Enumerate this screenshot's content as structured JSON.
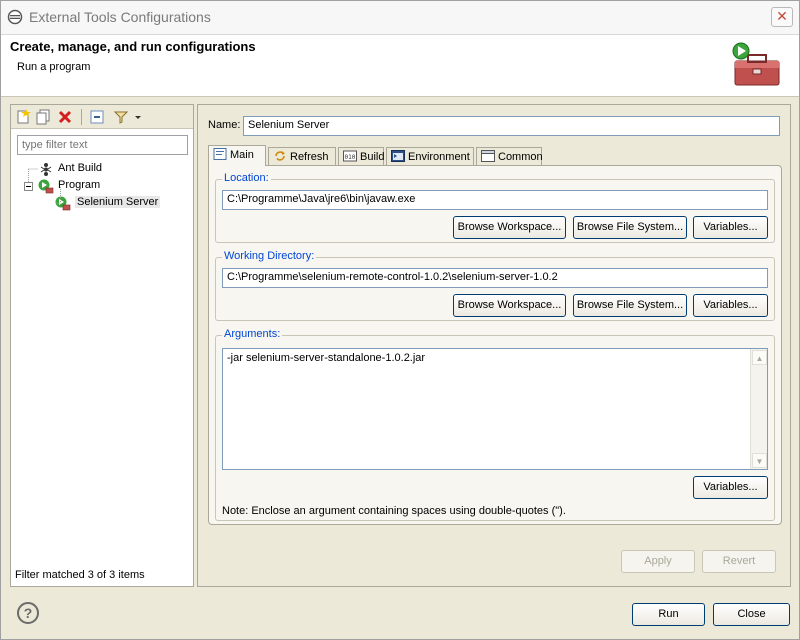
{
  "window": {
    "title": "External Tools Configurations",
    "close_glyph": "✕"
  },
  "header": {
    "title": "Create, manage, and run configurations",
    "subtitle": "Run a program",
    "icon": "toolbox-run-icon"
  },
  "left": {
    "toolbar": [
      {
        "name": "new-configuration-icon"
      },
      {
        "name": "duplicate-configuration-icon"
      },
      {
        "name": "delete-configuration-icon"
      },
      {
        "name": "collapse-all-icon"
      },
      {
        "name": "filter-configurations-icon"
      },
      {
        "name": "view-menu-dropdown-icon"
      }
    ],
    "filter_placeholder": "type filter text",
    "tree": [
      {
        "label": "Ant Build",
        "icon": "ant-icon",
        "level": 1
      },
      {
        "label": "Program",
        "icon": "program-icon",
        "level": 0,
        "expanded": true
      },
      {
        "label": "Selenium Server",
        "icon": "program-config-icon",
        "level": 2,
        "selected": true
      }
    ],
    "status": "Filter matched 3 of 3 items"
  },
  "right": {
    "name_label": "Name:",
    "name_value": "Selenium Server",
    "tabs": [
      {
        "label": "Main",
        "icon": "main-tab-icon",
        "active": true
      },
      {
        "label": "Refresh",
        "icon": "refresh-icon"
      },
      {
        "label": "Build",
        "icon": "build-icon"
      },
      {
        "label": "Environment",
        "icon": "environment-icon"
      },
      {
        "label": "Common",
        "icon": "common-icon"
      }
    ],
    "location": {
      "label": "Location:",
      "value": "C:\\Programme\\Java\\jre6\\bin\\javaw.exe",
      "browse_workspace": "Browse Workspace...",
      "browse_fs": "Browse File System...",
      "variables": "Variables..."
    },
    "working_dir": {
      "label": "Working Directory:",
      "value": "C:\\Programme\\selenium-remote-control-1.0.2\\selenium-server-1.0.2",
      "browse_workspace": "Browse Workspace...",
      "browse_fs": "Browse File System...",
      "variables": "Variables..."
    },
    "arguments": {
      "label": "Arguments:",
      "value": "-jar selenium-server-standalone-1.0.2.jar",
      "variables": "Variables...",
      "note": "Note: Enclose an argument containing spaces using double-quotes (\")."
    },
    "apply": "Apply",
    "revert": "Revert"
  },
  "footer": {
    "help": "?",
    "run": "Run",
    "close": "Close"
  }
}
